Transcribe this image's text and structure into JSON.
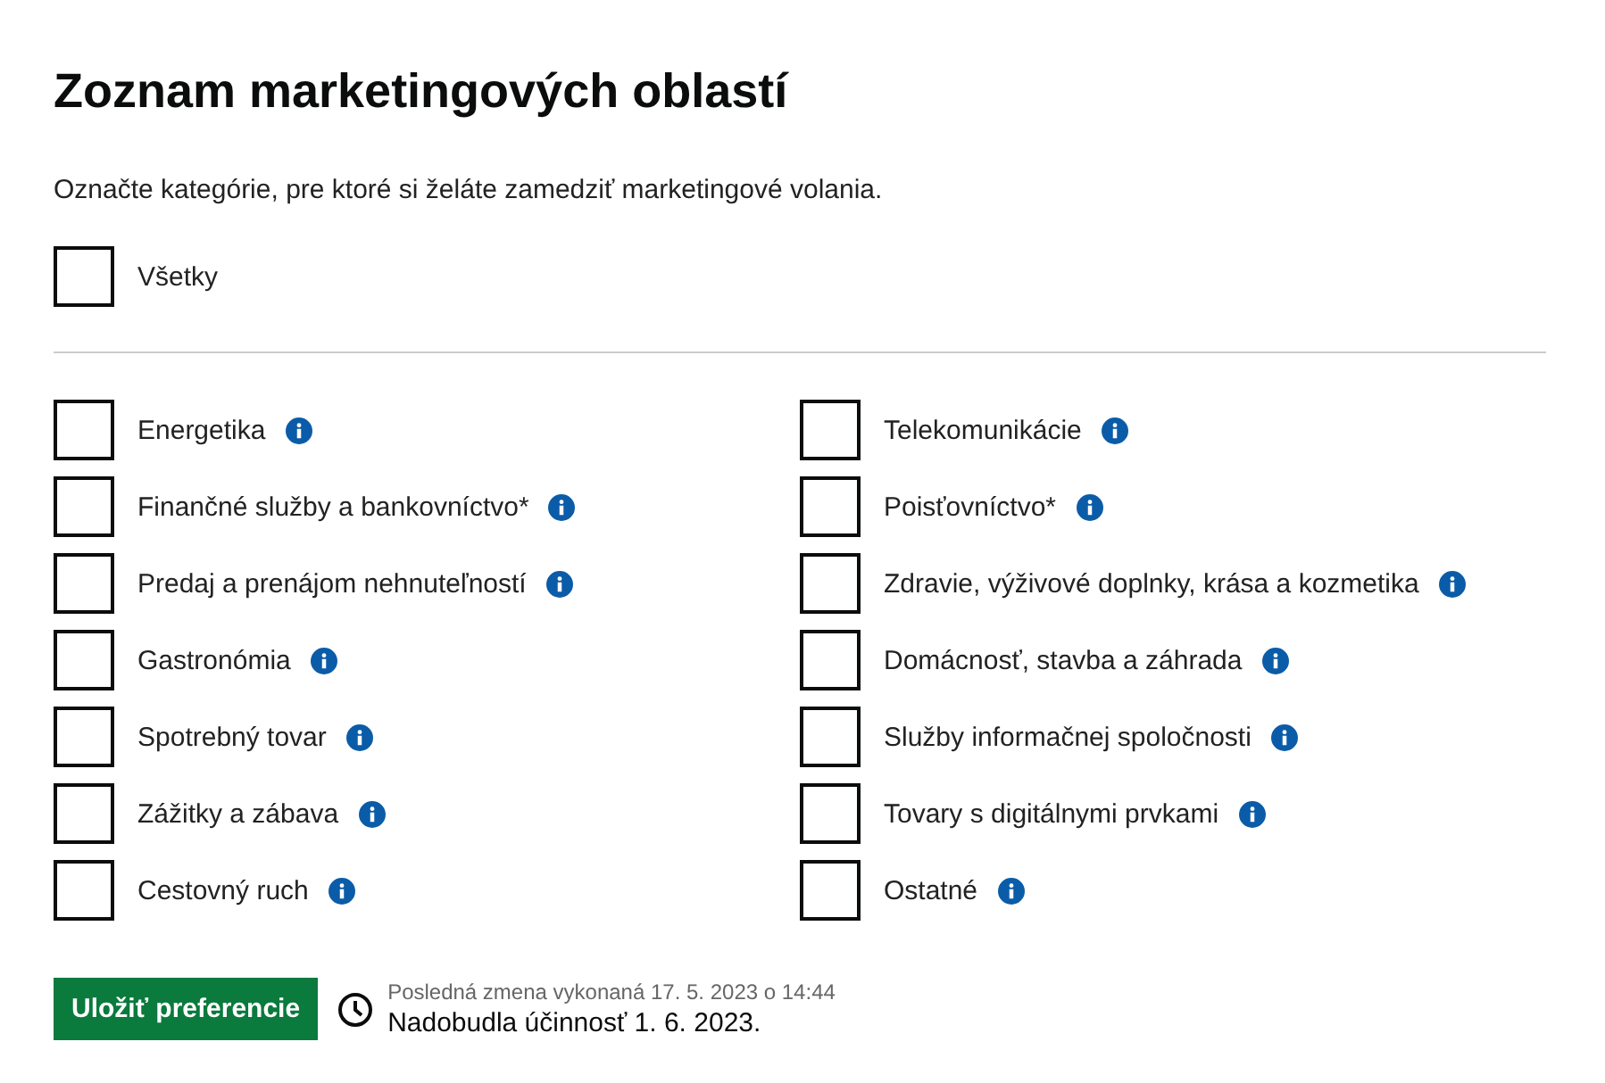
{
  "title": "Zoznam marketingových oblastí",
  "description": "Označte kategórie, pre ktoré si želáte zamedziť marketingové volania.",
  "all_option": {
    "label": "Všetky",
    "checked": false
  },
  "categories": [
    {
      "label": "Energetika",
      "checked": false
    },
    {
      "label": "Telekomunikácie",
      "checked": false
    },
    {
      "label": "Finančné služby a bankovníctvo*",
      "checked": false
    },
    {
      "label": "Poisťovníctvo*",
      "checked": false
    },
    {
      "label": "Predaj a prenájom nehnuteľností",
      "checked": false
    },
    {
      "label": "Zdravie, výživové doplnky, krása a kozmetika",
      "checked": false
    },
    {
      "label": "Gastronómia",
      "checked": false
    },
    {
      "label": "Domácnosť, stavba a záhrada",
      "checked": false
    },
    {
      "label": "Spotrebný tovar",
      "checked": false
    },
    {
      "label": "Služby informačnej spoločnosti",
      "checked": false
    },
    {
      "label": "Zážitky a zábava",
      "checked": false
    },
    {
      "label": "Tovary s digitálnymi prvkami",
      "checked": false
    },
    {
      "label": "Cestovný ruch",
      "checked": false
    },
    {
      "label": "Ostatné",
      "checked": false
    }
  ],
  "footer": {
    "button": "Uložiť preferencie",
    "last_change": "Posledná zmena vykonaná 17. 5. 2023 o 14:44",
    "effective": "Nadobudla účinnosť 1. 6. 2023."
  }
}
